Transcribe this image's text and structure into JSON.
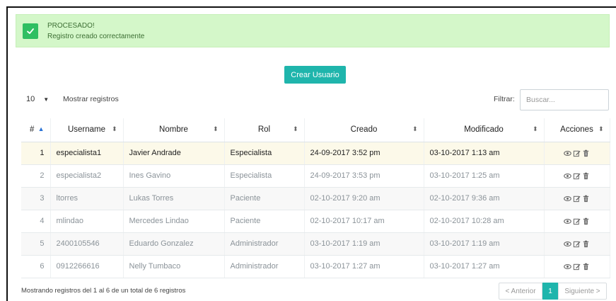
{
  "alert": {
    "title": "PROCESADO!",
    "message": "Registro creado correctamente"
  },
  "create_button": "Crear Usuario",
  "length": {
    "value": "10",
    "label": "Mostrar registros"
  },
  "filter": {
    "label": "Filtrar:",
    "placeholder": "Buscar..."
  },
  "table": {
    "columns": [
      "#",
      "Username",
      "Nombre",
      "Rol",
      "Creado",
      "Modificado",
      "Acciones"
    ],
    "sorted_column": "#",
    "sort_direction": "ascending",
    "selected_row": 1,
    "rows": [
      {
        "n": "1",
        "username": "especialista1",
        "nombre": "Javier Andrade",
        "rol": "Especialista",
        "creado": "24-09-2017 3:52 pm",
        "modificado": "03-10-2017 1:13 am"
      },
      {
        "n": "2",
        "username": "especialista2",
        "nombre": "Ines Gavino",
        "rol": "Especialista",
        "creado": "24-09-2017 3:53 pm",
        "modificado": "03-10-2017 1:25 am"
      },
      {
        "n": "3",
        "username": "ltorres",
        "nombre": "Lukas Torres",
        "rol": "Paciente",
        "creado": "02-10-2017 9:20 am",
        "modificado": "02-10-2017 9:36 am"
      },
      {
        "n": "4",
        "username": "mlindao",
        "nombre": "Mercedes Lindao",
        "rol": "Paciente",
        "creado": "02-10-2017 10:17 am",
        "modificado": "02-10-2017 10:28 am"
      },
      {
        "n": "5",
        "username": "2400105546",
        "nombre": "Eduardo Gonzalez",
        "rol": "Administrador",
        "creado": "03-10-2017 1:19 am",
        "modificado": "03-10-2017 1:19 am"
      },
      {
        "n": "6",
        "username": "0912266616",
        "nombre": "Nelly Tumbaco",
        "rol": "Administrador",
        "creado": "03-10-2017 1:27 am",
        "modificado": "03-10-2017 1:27 am"
      }
    ],
    "row_actions": [
      "eye-icon",
      "edit-icon",
      "trash-icon"
    ]
  },
  "footer": {
    "info": "Mostrando registros del 1 al 6 de un total de 6 registros",
    "prev": "< Anterior",
    "current_page": "1",
    "next": "Siguiente >"
  },
  "colors": {
    "accent": "#1fb5ac",
    "alert_bg": "#d4f7c9",
    "alert_icon": "#2fbf62",
    "selected_row": "#fcf9e9"
  }
}
